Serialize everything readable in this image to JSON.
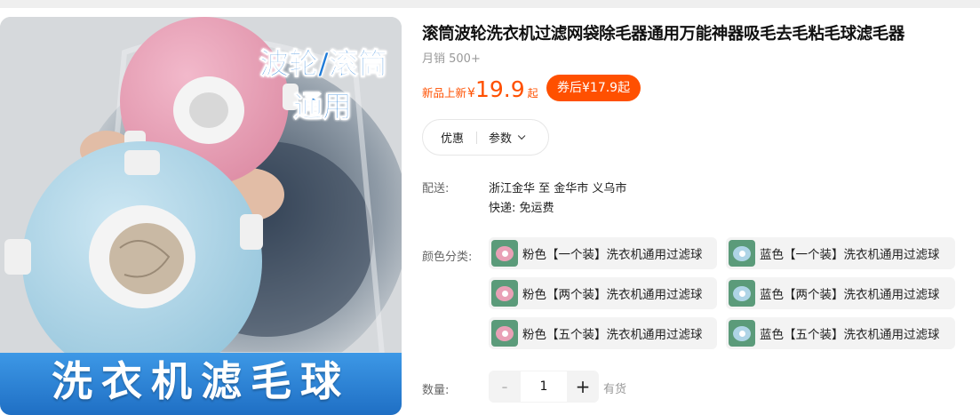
{
  "image": {
    "tag_line1": "波轮/滚筒",
    "tag_line2": "通用",
    "banner": "洗衣机滤毛球",
    "colors": {
      "pink_ball": "#e9a0b6",
      "blue_ball": "#aed4e6",
      "banner": "#2a84d6"
    }
  },
  "product": {
    "title": "滚筒波轮洗衣机过滤网袋除毛器通用万能神器吸毛去毛粘毛球滤毛器",
    "sales": "月销 500+"
  },
  "price": {
    "label": "新品上新",
    "currency": "¥",
    "value": "19.9",
    "suffix": "起",
    "coupon": "券后¥17.9起",
    "accent_color": "#ff5000"
  },
  "tabs": {
    "discount": "优惠",
    "params": "参数"
  },
  "shipping": {
    "label": "配送:",
    "route": "浙江金华 至 金华市 义乌市",
    "express": "快递: 免运费"
  },
  "variants": {
    "label": "颜色分类:",
    "items": [
      {
        "label": "粉色【一个装】洗衣机通用过滤球",
        "swatch": "pink"
      },
      {
        "label": "蓝色【一个装】洗衣机通用过滤球",
        "swatch": "blue"
      },
      {
        "label": "粉色【两个装】洗衣机通用过滤球",
        "swatch": "pink"
      },
      {
        "label": "蓝色【两个装】洗衣机通用过滤球",
        "swatch": "blue"
      },
      {
        "label": "粉色【五个装】洗衣机通用过滤球",
        "swatch": "pink"
      },
      {
        "label": "蓝色【五个装】洗衣机通用过滤球",
        "swatch": "blue"
      }
    ]
  },
  "quantity": {
    "label": "数量:",
    "minus": "-",
    "value": "1",
    "plus": "+",
    "stock": "有货"
  }
}
